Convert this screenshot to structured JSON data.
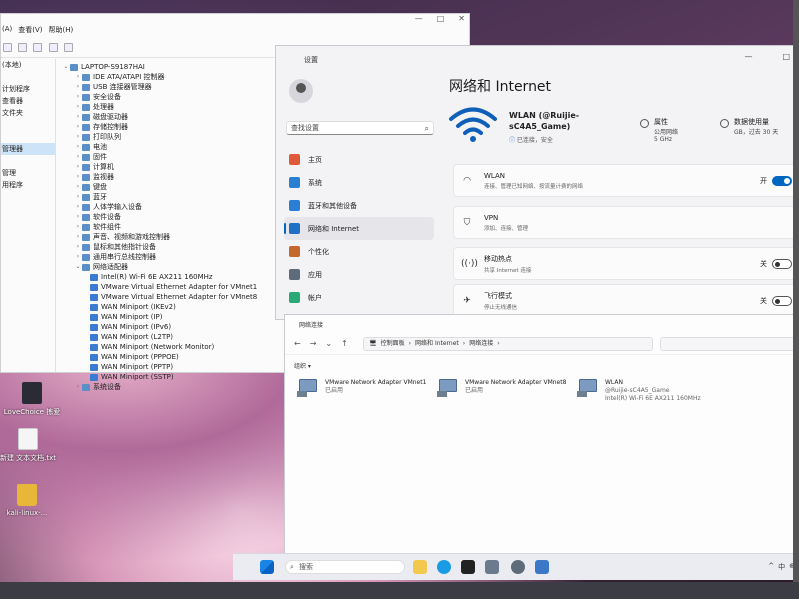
{
  "device_manager": {
    "menu": [
      "(A)",
      "查看(V)",
      "帮助(H)"
    ],
    "left_items": [
      "(本地)",
      "",
      "计划程序",
      "查看器",
      "文件夹",
      "",
      "",
      "管理器",
      "",
      "管理",
      "用程序"
    ],
    "tree": [
      {
        "level": 0,
        "exp": "⌄",
        "label": "LAPTOP-S9187HAI"
      },
      {
        "level": 1,
        "exp": "›",
        "label": "IDE ATA/ATAPI 控制器"
      },
      {
        "level": 1,
        "exp": "›",
        "label": "USB 连接器管理器"
      },
      {
        "level": 1,
        "exp": "›",
        "label": "安全设备"
      },
      {
        "level": 1,
        "exp": "›",
        "label": "处理器"
      },
      {
        "level": 1,
        "exp": "›",
        "label": "磁盘驱动器"
      },
      {
        "level": 1,
        "exp": "›",
        "label": "存储控制器"
      },
      {
        "level": 1,
        "exp": "›",
        "label": "打印队列"
      },
      {
        "level": 1,
        "exp": "›",
        "label": "电池"
      },
      {
        "level": 1,
        "exp": "›",
        "label": "固件"
      },
      {
        "level": 1,
        "exp": "›",
        "label": "计算机"
      },
      {
        "level": 1,
        "exp": "›",
        "label": "监视器"
      },
      {
        "level": 1,
        "exp": "›",
        "label": "键盘"
      },
      {
        "level": 1,
        "exp": "›",
        "label": "蓝牙"
      },
      {
        "level": 1,
        "exp": "›",
        "label": "人体学输入设备"
      },
      {
        "level": 1,
        "exp": "›",
        "label": "软件设备"
      },
      {
        "level": 1,
        "exp": "›",
        "label": "软件组件"
      },
      {
        "level": 1,
        "exp": "›",
        "label": "声音、视频和游戏控制器"
      },
      {
        "level": 1,
        "exp": "›",
        "label": "鼠标和其他指针设备"
      },
      {
        "level": 1,
        "exp": "›",
        "label": "通用串行总线控制器"
      },
      {
        "level": 1,
        "exp": "⌄",
        "label": "网络适配器"
      },
      {
        "level": 2,
        "exp": "",
        "label": "Intel(R) Wi-Fi 6E AX211 160MHz"
      },
      {
        "level": 2,
        "exp": "",
        "label": "VMware Virtual Ethernet Adapter for VMnet1"
      },
      {
        "level": 2,
        "exp": "",
        "label": "VMware Virtual Ethernet Adapter for VMnet8"
      },
      {
        "level": 2,
        "exp": "",
        "label": "WAN Miniport (IKEv2)"
      },
      {
        "level": 2,
        "exp": "",
        "label": "WAN Miniport (IP)"
      },
      {
        "level": 2,
        "exp": "",
        "label": "WAN Miniport (IPv6)"
      },
      {
        "level": 2,
        "exp": "",
        "label": "WAN Miniport (L2TP)"
      },
      {
        "level": 2,
        "exp": "",
        "label": "WAN Miniport (Network Monitor)"
      },
      {
        "level": 2,
        "exp": "",
        "label": "WAN Miniport (PPPOE)"
      },
      {
        "level": 2,
        "exp": "",
        "label": "WAN Miniport (PPTP)"
      },
      {
        "level": 2,
        "exp": "",
        "label": "WAN Miniport (SSTP)"
      },
      {
        "level": 1,
        "exp": "›",
        "label": "系统设备"
      }
    ]
  },
  "desktop": {
    "icons": [
      {
        "label": "LoveChoice 拣爱",
        "kind": "app"
      },
      {
        "label": "新建 文本文档.txt",
        "kind": "doc"
      },
      {
        "label": "kali-linux-...",
        "kind": "folder"
      }
    ]
  },
  "settings": {
    "title": "设置",
    "search_placeholder": "查找设置",
    "nav": [
      {
        "label": "主页",
        "color": "#e05a3a"
      },
      {
        "label": "系统",
        "color": "#2a7fd4"
      },
      {
        "label": "蓝牙和其他设备",
        "color": "#2a7fd4"
      },
      {
        "label": "网络和 Internet",
        "color": "#1f6fc4"
      },
      {
        "label": "个性化",
        "color": "#c2692b"
      },
      {
        "label": "应用",
        "color": "#5d6b7a"
      },
      {
        "label": "帐户",
        "color": "#2aa876"
      },
      {
        "label": "时间和语言",
        "color": "#2a7fd4"
      }
    ],
    "heading": "网络和 Internet",
    "wlan_name": "WLAN (@Ruijie-sC4A5_Game)",
    "wlan_status": "已连接，安全",
    "props_title": "属性",
    "props_sub1": "公用网络",
    "props_sub2": "5 GHz",
    "usage_title": "数据使用量",
    "usage_sub": "GB，过去 30 天",
    "cards": [
      {
        "icon": "wifi",
        "title": "WLAN",
        "sub": "连接、管理已知网络、按流量计费的网络",
        "toggle": "on",
        "toggle_label": "开"
      },
      {
        "icon": "shield",
        "title": "VPN",
        "sub": "添加、连接、管理",
        "toggle": "",
        "toggle_label": ""
      },
      {
        "icon": "hotspot",
        "title": "移动热点",
        "sub": "共享 Internet 连接",
        "toggle": "off",
        "toggle_label": "关"
      },
      {
        "icon": "plane",
        "title": "飞行模式",
        "sub": "停止无线通信",
        "toggle": "off",
        "toggle_label": "关"
      }
    ],
    "controls": [
      "—",
      "□"
    ]
  },
  "network_connections": {
    "title": "网络连接",
    "breadcrumb": [
      "控制面板",
      "网络和 Internet",
      "网络连接"
    ],
    "organize": "组织 ▾",
    "adapters": [
      {
        "name": "VMware Network Adapter VMnet1",
        "status": "已启用",
        "detail": ""
      },
      {
        "name": "VMware Network Adapter VMnet8",
        "status": "已启用",
        "detail": ""
      },
      {
        "name": "WLAN",
        "status": "@Ruijie-sC4A5_Game",
        "detail": "Intel(R) Wi-Fi 6E AX211 160MHz"
      }
    ]
  },
  "taskbar": {
    "search": "搜索",
    "tray": [
      "^",
      "中",
      "⊕"
    ]
  }
}
